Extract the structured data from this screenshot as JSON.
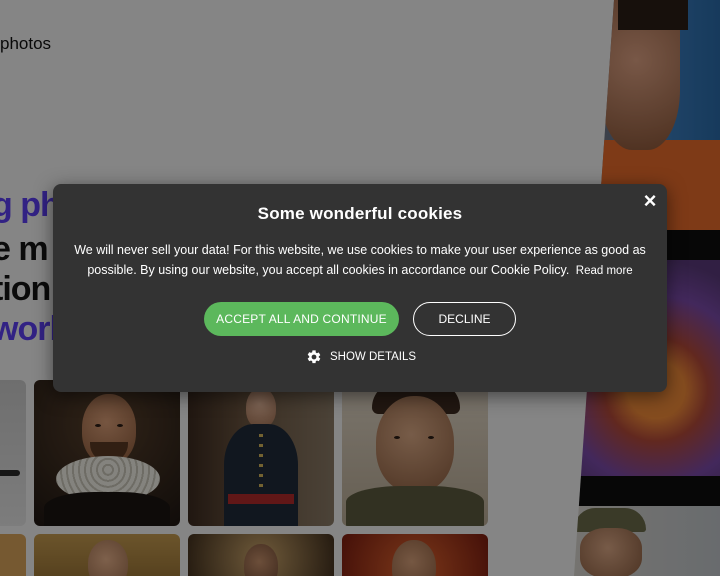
{
  "header": {
    "logo_text": "photos"
  },
  "hero": {
    "line1": "g ph",
    "line2": "e m",
    "line3": "tion",
    "line4": "world"
  },
  "cookie_banner": {
    "title": "Some wonderful cookies",
    "message": "We will never sell your data! For this website, we use cookies to make your user experience as good as possible. By using our website, you accept all cookies in accordance our Cookie Policy.",
    "read_more": "Read more",
    "accept_label": "ACCEPT ALL AND CONTINUE",
    "decline_label": "DECLINE",
    "details_label": "SHOW DETAILS",
    "close_icon": "×",
    "accept_color": "#5cb85c",
    "dialog_color": "#333333"
  }
}
